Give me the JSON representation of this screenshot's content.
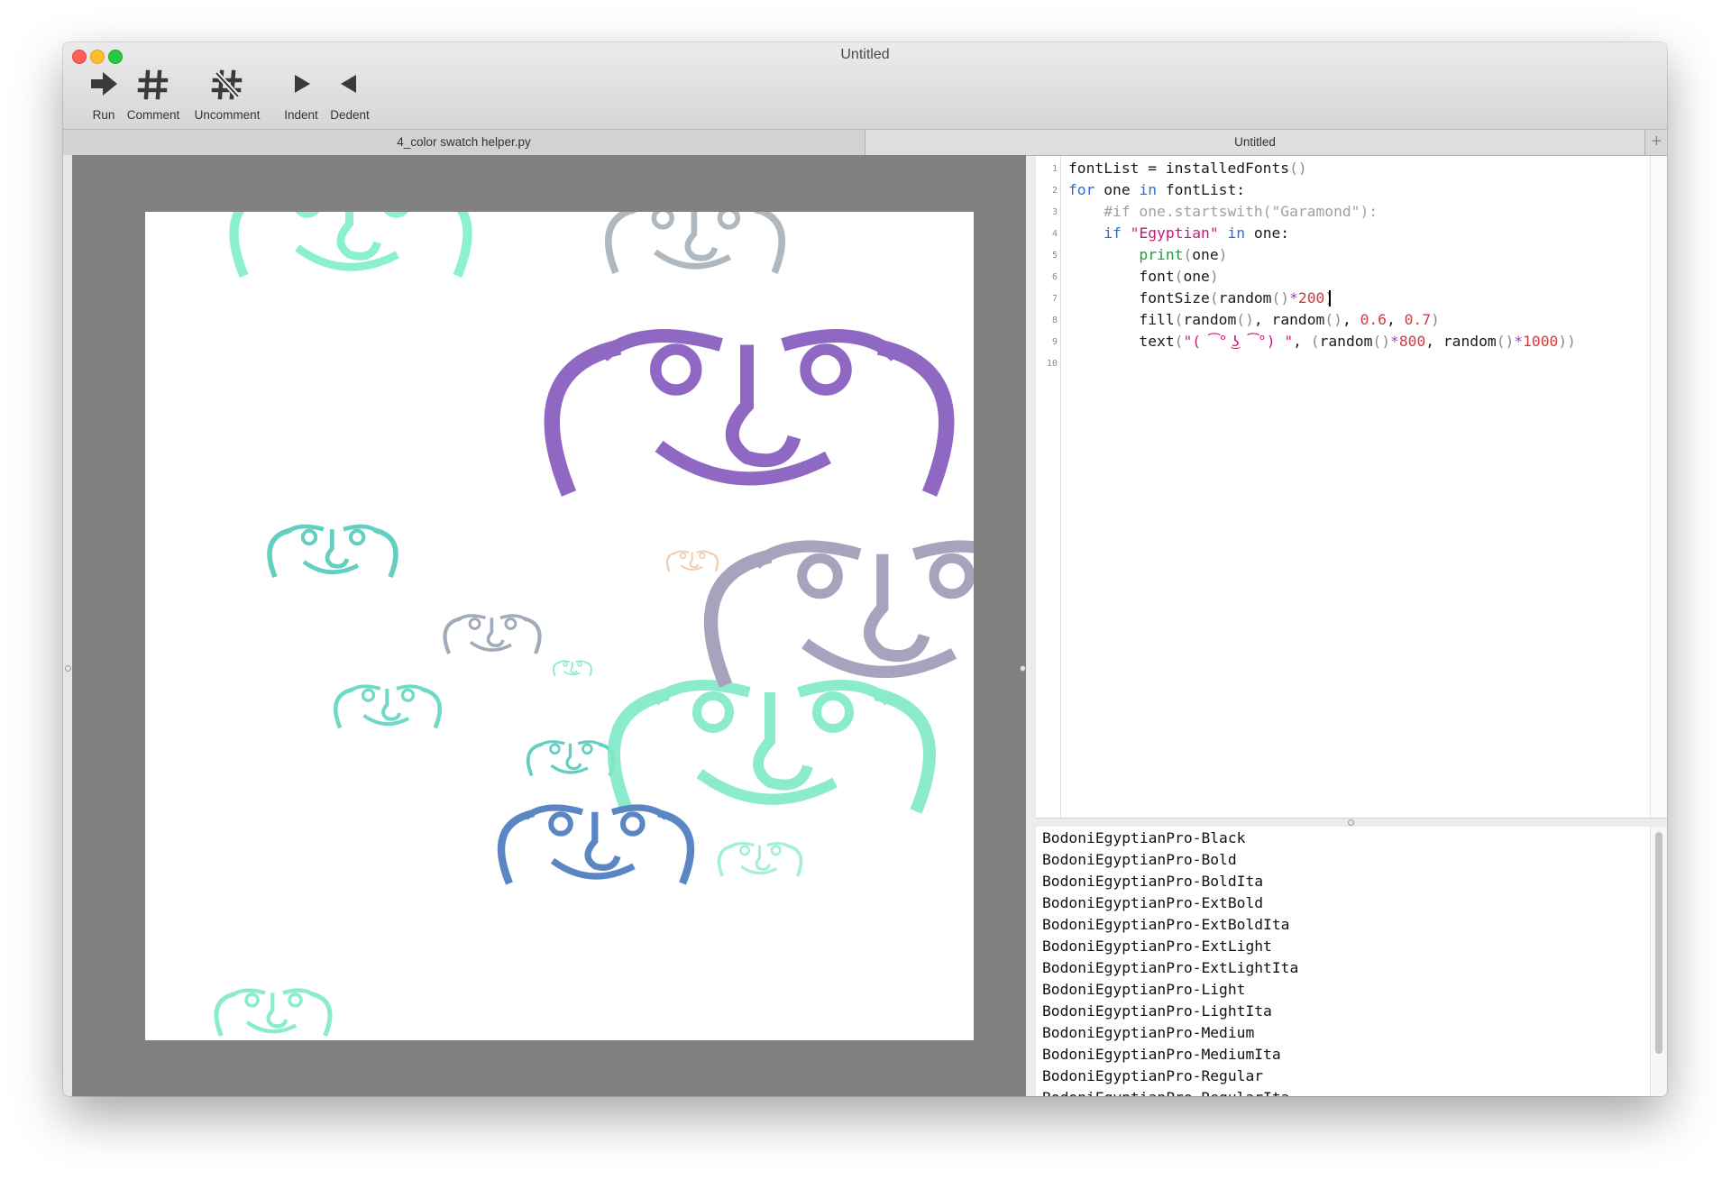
{
  "window": {
    "title": "Untitled"
  },
  "toolbar": {
    "items": [
      {
        "label": "Run",
        "icon": "arrow-right-icon"
      },
      {
        "label": "Comment",
        "icon": "hash-icon"
      },
      {
        "label": "Uncomment",
        "icon": "hash-slash-icon"
      },
      {
        "label": "Indent",
        "icon": "triangle-right-icon"
      },
      {
        "label": "Dedent",
        "icon": "triangle-left-icon"
      }
    ]
  },
  "tabs": {
    "left": "4_color swatch helper.py",
    "right": "Untitled",
    "add": "+"
  },
  "canvas": {
    "face_text": "( ͡° ͜ʖ ͡°)",
    "face_colors": [
      "#7ff0c8",
      "#b0b8bf",
      "#8a60c0",
      "#62cfc0",
      "#a0aab8",
      "#a8a3bc",
      "#f4c9a8",
      "#7fe9c8",
      "#5a86c4"
    ]
  },
  "editor": {
    "line_numbers": [
      "1",
      "2",
      "3",
      "4",
      "5",
      "6",
      "7",
      "8",
      "9",
      "10"
    ],
    "code_lines": [
      "fontList = installedFonts()",
      "for one in fontList:",
      "    #if one.startswith(\"Garamond\"):",
      "    if \"Egyptian\" in one:",
      "        print(one)",
      "        font(one)",
      "        fontSize(random()*200)",
      "        fill(random(), random(), 0.6, 0.7)",
      "        text(\"( ͡° ͜ʖ ͡°) \", (random()*800, random()*1000))",
      ""
    ],
    "colors": {
      "keyword": "#2f6bd5",
      "string": "#c81a78",
      "comment": "#a0a0a0",
      "function": "#1f9f3a",
      "number": "#d43b3b",
      "operator": "#9a3ccf"
    }
  },
  "output": {
    "lines": [
      "BodoniEgyptianPro-Black",
      "BodoniEgyptianPro-Bold",
      "BodoniEgyptianPro-BoldIta",
      "BodoniEgyptianPro-ExtBold",
      "BodoniEgyptianPro-ExtBoldIta",
      "BodoniEgyptianPro-ExtLight",
      "BodoniEgyptianPro-ExtLightIta",
      "BodoniEgyptianPro-Light",
      "BodoniEgyptianPro-LightIta",
      "BodoniEgyptianPro-Medium",
      "BodoniEgyptianPro-MediumIta",
      "BodoniEgyptianPro-Regular",
      "BodoniEgyptianPro-RegularIta"
    ]
  }
}
